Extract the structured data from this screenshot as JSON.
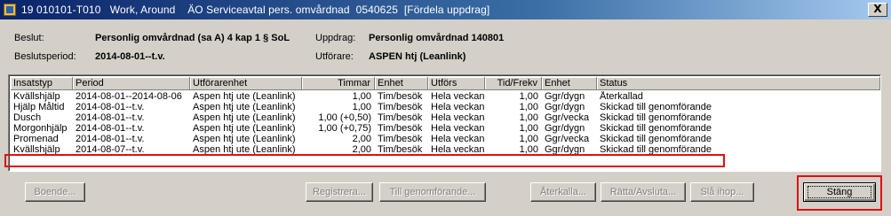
{
  "window": {
    "title": "19 010101-T010   Work, Around    ÄO Serviceavtal pers. omvårdnad  0540625  [Fördela uppdrag]",
    "close_glyph": "X"
  },
  "details": {
    "beslut_label": "Beslut:",
    "beslut_value": "Personlig omvårdnad (sa A) 4 kap 1 § SoL",
    "uppdrag_label": "Uppdrag:",
    "uppdrag_value": "Personlig omvårdnad 140801",
    "period_label": "Beslutsperiod:",
    "period_value": "2014-08-01--t.v.",
    "utforare_label": "Utförare:",
    "utforare_value": "ASPEN htj (Leanlink)"
  },
  "grid": {
    "columns": [
      "Insatstyp",
      "Period",
      "Utförarenhet",
      "Timmar",
      "Enhet",
      "Utförs",
      "Tid/Frekv",
      "Enhet",
      "Status"
    ],
    "rows": [
      [
        "Kvällshjälp",
        "2014-08-01--2014-08-06",
        "Aspen htj ute (Leanlink)",
        "1,00",
        "Tim/besök",
        "Hela veckan",
        "1,00",
        "Ggr/dygn",
        "Återkallad"
      ],
      [
        "Hjälp Måltid",
        "2014-08-01--t.v.",
        "Aspen htj ute (Leanlink)",
        "1,00",
        "Tim/besök",
        "Hela veckan",
        "1,00",
        "Ggr/dygn",
        "Skickad till genomförande"
      ],
      [
        "Dusch",
        "2014-08-01--t.v.",
        "Aspen htj ute (Leanlink)",
        "1,00 (+0,50)",
        "Tim/besök",
        "Hela veckan",
        "1,00",
        "Ggr/vecka",
        "Skickad till genomförande"
      ],
      [
        "Morgonhjälp",
        "2014-08-01--t.v.",
        "Aspen htj ute (Leanlink)",
        "1,00 (+0,75)",
        "Tim/besök",
        "Hela veckan",
        "1,00",
        "Ggr/dygn",
        "Skickad till genomförande"
      ],
      [
        "Promenad",
        "2014-08-01--t.v.",
        "Aspen htj ute (Leanlink)",
        "2,00",
        "Tim/besök",
        "Hela veckan",
        "1,00",
        "Ggr/vecka",
        "Skickad till genomförande"
      ],
      [
        "Kvällshjälp",
        "2014-08-07--t.v.",
        "Aspen htj ute (Leanlink)",
        "2,00",
        "Tim/besök",
        "Hela veckan",
        "1,00",
        "Ggr/dygn",
        "Skickad till genomförande"
      ]
    ]
  },
  "buttons": {
    "boende": "Boende...",
    "registrera": "Registrera...",
    "till_genomforande": "Till genomförande...",
    "aterkalla": "Återkalla...",
    "ratta_avsluta": "Rätta/Avsluta...",
    "sla_ihop": "Slå ihop...",
    "stang": "Stäng"
  }
}
